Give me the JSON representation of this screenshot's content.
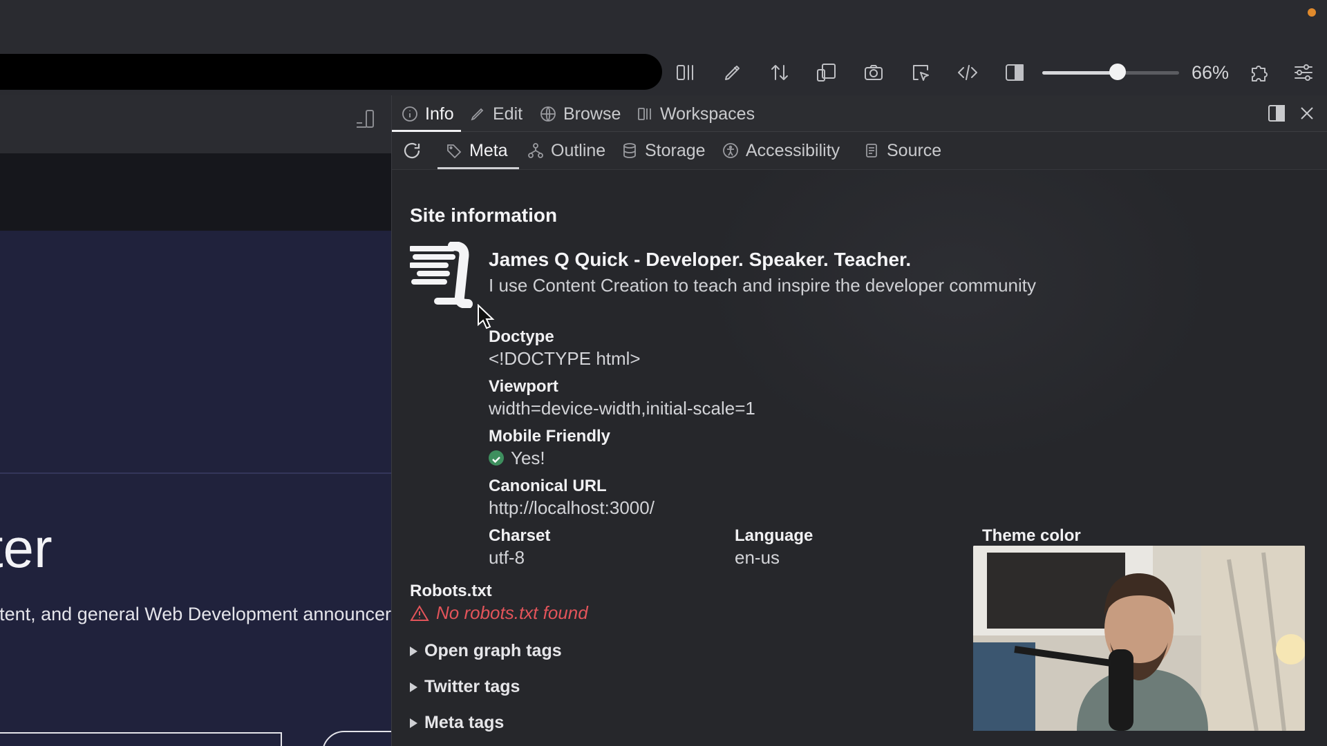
{
  "toolbar": {
    "zoom_value": 0.55,
    "zoom_label": "66%",
    "icons": [
      "split-view-icon",
      "pen-icon",
      "arrows-up-down-icon",
      "devices-icon",
      "camera-icon",
      "select-cursor-icon",
      "code-icon",
      "sidebar-icon",
      "puzzle-icon",
      "sliders-icon"
    ]
  },
  "left_page": {
    "heading_fragment": "tter",
    "text_fragment": "tent, and general Web Development announcer"
  },
  "tabs_primary": [
    {
      "label": "Info",
      "icon": "info-icon",
      "active": true
    },
    {
      "label": "Edit",
      "icon": "pencil-icon",
      "active": false
    },
    {
      "label": "Browse",
      "icon": "globe-icon",
      "active": false
    },
    {
      "label": "Workspaces",
      "icon": "workspaces-icon",
      "active": false
    }
  ],
  "tabs_secondary": [
    {
      "label": "Meta",
      "icon": "tag-icon",
      "active": true
    },
    {
      "label": "Outline",
      "icon": "outline-icon",
      "active": false
    },
    {
      "label": "Storage",
      "icon": "database-icon",
      "active": false
    },
    {
      "label": "Accessibility",
      "icon": "accessibility-icon",
      "active": false
    },
    {
      "label": "Source",
      "icon": "document-icon",
      "active": false
    }
  ],
  "site": {
    "section_title": "Site information",
    "title": "James Q Quick - Developer. Speaker. Teacher.",
    "description": "I use Content Creation to teach and inspire the developer community",
    "doctype_label": "Doctype",
    "doctype_value": "<!DOCTYPE html>",
    "viewport_label": "Viewport",
    "viewport_value": "width=device-width,initial-scale=1",
    "mobile_label": "Mobile Friendly",
    "mobile_value": "Yes!",
    "canonical_label": "Canonical URL",
    "canonical_value": "http://localhost:3000/",
    "charset_label": "Charset",
    "charset_value": "utf-8",
    "language_label": "Language",
    "language_value": "en-us",
    "theme_label": "Theme color",
    "robots_label": "Robots.txt",
    "robots_value": "No robots.txt found"
  },
  "disclosures": [
    "Open graph tags",
    "Twitter tags",
    "Meta tags"
  ],
  "colors": {
    "error": "#e3545a",
    "success": "#3e8f5e",
    "record_indicator": "#e08a2c"
  }
}
